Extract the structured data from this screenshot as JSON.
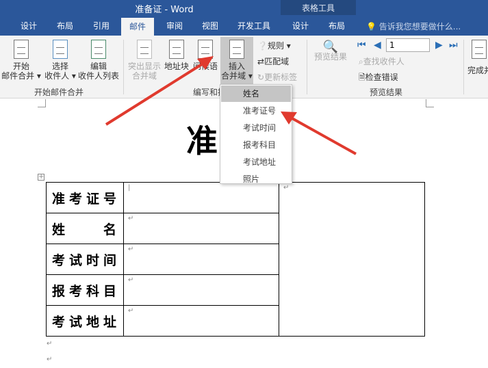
{
  "window": {
    "title": "准备证 - Word",
    "context_tab_group": "表格工具"
  },
  "tabs": [
    {
      "label": "设计"
    },
    {
      "label": "布局"
    },
    {
      "label": "引用"
    },
    {
      "label": "邮件"
    },
    {
      "label": "审阅"
    },
    {
      "label": "视图"
    },
    {
      "label": "开发工具"
    },
    {
      "label": "设计"
    },
    {
      "label": "布局"
    }
  ],
  "tell_me": "告诉我您想要做什么...",
  "ribbon": {
    "start_merge": {
      "label1": "开始",
      "label2": "邮件合并 ▾",
      "group": "开始邮件合并"
    },
    "select_recipients": {
      "label1": "选择",
      "label2": "收件人 ▾"
    },
    "edit_recipients": {
      "label1": "编辑",
      "label2": "收件人列表"
    },
    "highlight": {
      "label1": "突出显示",
      "label2": "合并域"
    },
    "address_block": "地址块",
    "greeting": "问候语",
    "insert_field": {
      "label1": "插入",
      "label2": "合并域 ▾"
    },
    "rules": "规则 ▾",
    "match_fields": "匹配域",
    "update_labels": "更新标签",
    "write_group": "编写和插入域",
    "preview": "预览结果",
    "record": "1",
    "find_recipient": "查找收件人",
    "check_errors": "检查错误",
    "preview_group": "预览结果",
    "finish": "完成并"
  },
  "menu": [
    "姓名",
    "准考证号",
    "考试时间",
    "报考科目",
    "考试地址",
    "照片"
  ],
  "document": {
    "title": "准",
    "rows": [
      "准考证号",
      "姓　　名",
      "考试时间",
      "报考科目",
      "考试地址"
    ],
    "para_mark": "↵"
  }
}
